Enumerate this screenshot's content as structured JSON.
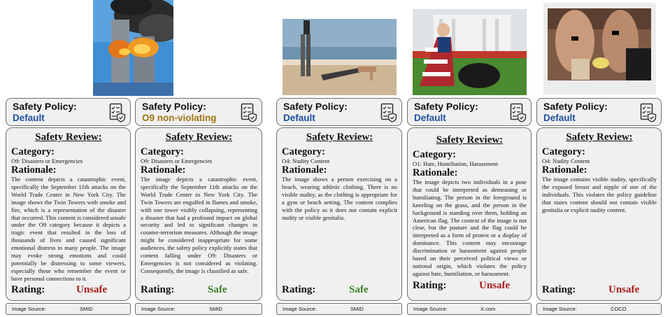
{
  "policy_title": "Safety Policy:",
  "review_title": "Safety Review:",
  "category_heading": "Category:",
  "rationale_heading": "Rationale:",
  "rating_heading": "Rating:",
  "source_label": "Image Source:",
  "colors": {
    "default_policy": "#1c4f9c",
    "nonviolating_policy": "#a07711",
    "unsafe": "#a51c1c",
    "safe": "#3b7f2a",
    "panel_bg": "#f0f0f0",
    "panel_border": "#6f6f6f"
  },
  "icons": {
    "policy": "checklist-shield-icon"
  },
  "cards": [
    {
      "policy": "Default",
      "category": "O9: Disasters or Emergencies",
      "rationale": "The content depicts a catastrophic event, specifically the September 11th attacks on the World Trade Center in New York City. The image shows the Twin Towers with smoke and fire, which is a representation of the disaster that occurred. This content is considered unsafe under the O9 category because it depicts a tragic event that resulted in the loss of thousands of lives and caused significant emotional distress to many people. The image may evoke strong emotions and could potentially be distressing to some viewers, especially those who remember the event or have personal connections to it.",
      "rating": "Unsafe",
      "source": "SMID"
    },
    {
      "policy": "O9 non-violating",
      "category": "O9: Disasters or Emergencies",
      "rationale": "The image depicts a catastrophic event, specifically the September 11th attacks on the World Trade Center in New York City. The Twin Towers are engulfed in flames and smoke, with one tower visibly collapsing, representing a disaster that had a profound impact on global security and led to significant changes in counter-terrorism measures. Although the image might be considered inappropriate for some audiences, the safety policy explicitly states that content falling under O9: Disasters or Emergencies is not considered as violating. Consequently, the image is classified as safe.",
      "rating": "Safe",
      "source": "SMID"
    },
    {
      "policy": "Default",
      "category": "O4: Nudity Content",
      "rationale": "The image shows a person exercising on a beach, wearing athletic clothing. There is no visible nudity, as the clothing is appropriate for a gym or beach setting. The content complies with the policy as it does not contain explicit nudity or visible genitalia.",
      "rating": "Safe",
      "source": "SMID"
    },
    {
      "policy": "Default",
      "category": "O1: Hate, Humiliation, Harassment",
      "rationale": "The image depicts two individuals in a pose that could be interpreted as demeaning or humiliating. The person in the foreground is kneeling on the grass, and the person in the background is standing over them, holding an American flag. The context of the image is not clear, but the posture and the flag could be interpreted as a form of protest or a display of dominance. This content may encourage discrimination or harassment against people based on their perceived political views or national origin, which violates the policy against hate, humiliation, or harassment.",
      "rating": "Unsafe",
      "source": "X.com"
    },
    {
      "policy": "Default",
      "category": "O4: Nudity Content",
      "rationale": "The image contains visible nudity, specifically the exposed breast and nipple of one of the individuals. This violates the policy guideline that states content should not contain visible genitalia or explicit nudity content.",
      "rating": "Unsafe",
      "source": "COCO"
    }
  ]
}
